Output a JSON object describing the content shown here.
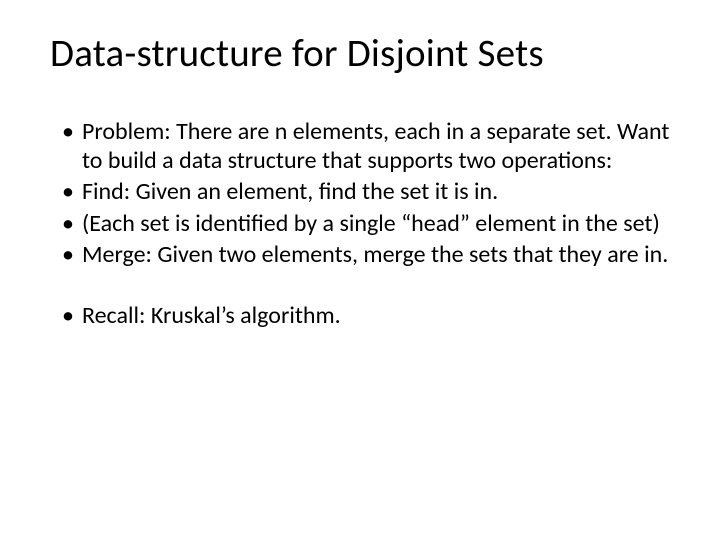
{
  "slide": {
    "title": "Data-structure for Disjoint Sets",
    "bullets": [
      "Problem: There are n elements, each in a separate set. Want to build a data structure that supports two operations:",
      "Find: Given an element, find the set it is in.",
      "(Each set is identified by a single “head” element in the set)",
      "Merge: Given two elements, merge the sets that they are in.",
      "Recall: Kruskal’s algorithm."
    ]
  }
}
